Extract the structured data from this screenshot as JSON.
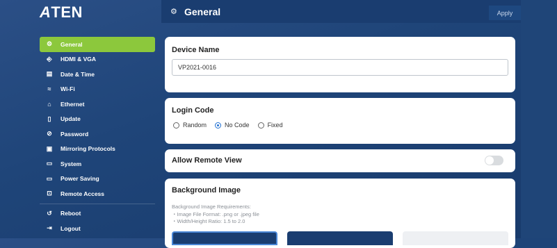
{
  "brand": {
    "logo_a": "A",
    "logo_rest": "TEN"
  },
  "sidebar": {
    "items": [
      {
        "label": "General",
        "icon": "gear-icon",
        "glyph": "⚙"
      },
      {
        "label": "HDMI & VGA",
        "icon": "hdmi-icon",
        "glyph": "⎆"
      },
      {
        "label": "Date & Time",
        "icon": "calendar-icon",
        "glyph": "▤"
      },
      {
        "label": "Wi-Fi",
        "icon": "wifi-icon",
        "glyph": "≈"
      },
      {
        "label": "Ethernet",
        "icon": "ethernet-icon",
        "glyph": "⌂"
      },
      {
        "label": "Update",
        "icon": "update-icon",
        "glyph": "▯"
      },
      {
        "label": "Password",
        "icon": "password-icon",
        "glyph": "⊘"
      },
      {
        "label": "Mirroring Protocols",
        "icon": "mirroring-icon",
        "glyph": "▣"
      },
      {
        "label": "System",
        "icon": "system-icon",
        "glyph": "▭"
      },
      {
        "label": "Power Saving",
        "icon": "power-saving-icon",
        "glyph": "▭"
      },
      {
        "label": "Remote Access",
        "icon": "remote-access-icon",
        "glyph": "⊡"
      }
    ],
    "bottom_items": [
      {
        "label": "Reboot",
        "icon": "reboot-icon",
        "glyph": "↺"
      },
      {
        "label": "Logout",
        "icon": "logout-icon",
        "glyph": "⇥"
      }
    ]
  },
  "header": {
    "title": "General",
    "icon": "gear-icon",
    "glyph": "⚙",
    "apply_label": "Apply"
  },
  "device_name": {
    "title": "Device Name",
    "value": "VP2021-0016"
  },
  "login_code": {
    "title": "Login Code",
    "options": [
      "Random",
      "No Code",
      "Fixed"
    ],
    "selected": "No Code"
  },
  "remote_view": {
    "title": "Allow Remote View",
    "enabled": false
  },
  "background_image": {
    "title": "Background Image",
    "requirements_heading": "Background Image Requirements:",
    "requirements": [
      "・Image File Format: .png or .jpeg file",
      "・Width/Height Ratio: 1.5 to 2.0"
    ]
  },
  "colors": {
    "accent": "#8cc83c",
    "header": "#1a3d70",
    "radio": "#1f6fd1"
  }
}
